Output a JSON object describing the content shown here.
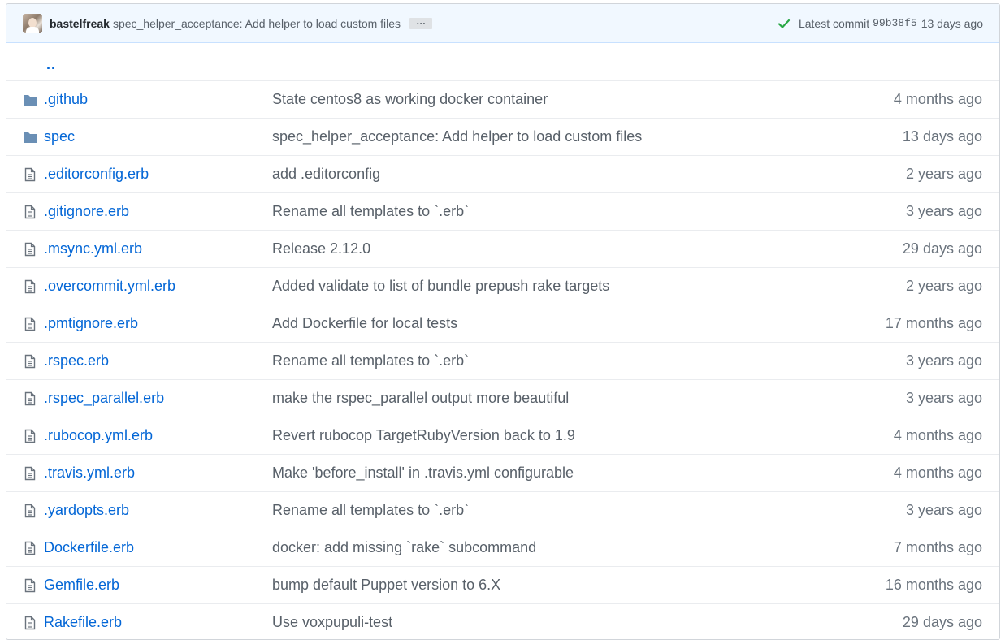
{
  "commit": {
    "author": "bastelfreak",
    "message": "spec_helper_acceptance: Add helper to load custom files",
    "ellipsis": "…",
    "latest_label": "Latest commit",
    "sha": "99b38f5",
    "age": "13 days ago",
    "status_color": "#28a745"
  },
  "parent_link": "..",
  "files": [
    {
      "type": "dir",
      "icon": "folder-icon",
      "name": ".github",
      "message": "State centos8 as working docker container",
      "age": "4 months ago"
    },
    {
      "type": "dir",
      "icon": "folder-icon",
      "name": "spec",
      "message": "spec_helper_acceptance: Add helper to load custom files",
      "age": "13 days ago"
    },
    {
      "type": "file",
      "icon": "file-icon",
      "name": ".editorconfig.erb",
      "message": "add .editorconfig",
      "age": "2 years ago"
    },
    {
      "type": "file",
      "icon": "file-icon",
      "name": ".gitignore.erb",
      "message": "Rename all templates to `.erb`",
      "age": "3 years ago"
    },
    {
      "type": "file",
      "icon": "file-icon",
      "name": ".msync.yml.erb",
      "message": "Release 2.12.0",
      "age": "29 days ago"
    },
    {
      "type": "file",
      "icon": "file-icon",
      "name": ".overcommit.yml.erb",
      "message": "Added validate to list of bundle prepush rake targets",
      "age": "2 years ago"
    },
    {
      "type": "file",
      "icon": "file-icon",
      "name": ".pmtignore.erb",
      "message": "Add Dockerfile for local tests",
      "age": "17 months ago"
    },
    {
      "type": "file",
      "icon": "file-icon",
      "name": ".rspec.erb",
      "message": "Rename all templates to `.erb`",
      "age": "3 years ago"
    },
    {
      "type": "file",
      "icon": "file-icon",
      "name": ".rspec_parallel.erb",
      "message": "make the rspec_parallel output more beautiful",
      "age": "3 years ago"
    },
    {
      "type": "file",
      "icon": "file-icon",
      "name": ".rubocop.yml.erb",
      "message": "Revert rubocop TargetRubyVersion back to 1.9",
      "age": "4 months ago"
    },
    {
      "type": "file",
      "icon": "file-icon",
      "name": ".travis.yml.erb",
      "message": "Make 'before_install' in .travis.yml configurable",
      "age": "4 months ago"
    },
    {
      "type": "file",
      "icon": "file-icon",
      "name": ".yardopts.erb",
      "message": "Rename all templates to `.erb`",
      "age": "3 years ago"
    },
    {
      "type": "file",
      "icon": "file-icon",
      "name": "Dockerfile.erb",
      "message": "docker: add missing `rake` subcommand",
      "age": "7 months ago"
    },
    {
      "type": "file",
      "icon": "file-icon",
      "name": "Gemfile.erb",
      "message": "bump default Puppet version to 6.X",
      "age": "16 months ago"
    },
    {
      "type": "file",
      "icon": "file-icon",
      "name": "Rakefile.erb",
      "message": "Use voxpupuli-test",
      "age": "29 days ago"
    }
  ],
  "colors": {
    "link": "#0366d6",
    "folder": "#79b8ff",
    "file_icon": "#6a737d",
    "header_bg": "#f1f8ff"
  }
}
